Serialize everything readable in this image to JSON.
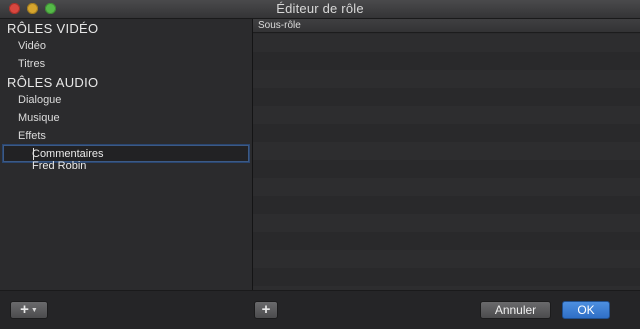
{
  "window": {
    "title": "Éditeur de rôle"
  },
  "roles": {
    "video_header": "RÔLES VIDÉO",
    "video_items": [
      "Vidéo",
      "Titres"
    ],
    "audio_header": "RÔLES AUDIO",
    "audio_items": [
      "Dialogue",
      "Musique",
      "Effets"
    ],
    "editing_value": "Commentaires Fred Robin"
  },
  "subroles": {
    "column_header": "Sous-rôle"
  },
  "footer": {
    "add_role_icon": "plus-icon",
    "add_subrole_icon": "plus-icon",
    "cancel_label": "Annuler",
    "ok_label": "OK",
    "accent_color": "#3a7bd5"
  }
}
